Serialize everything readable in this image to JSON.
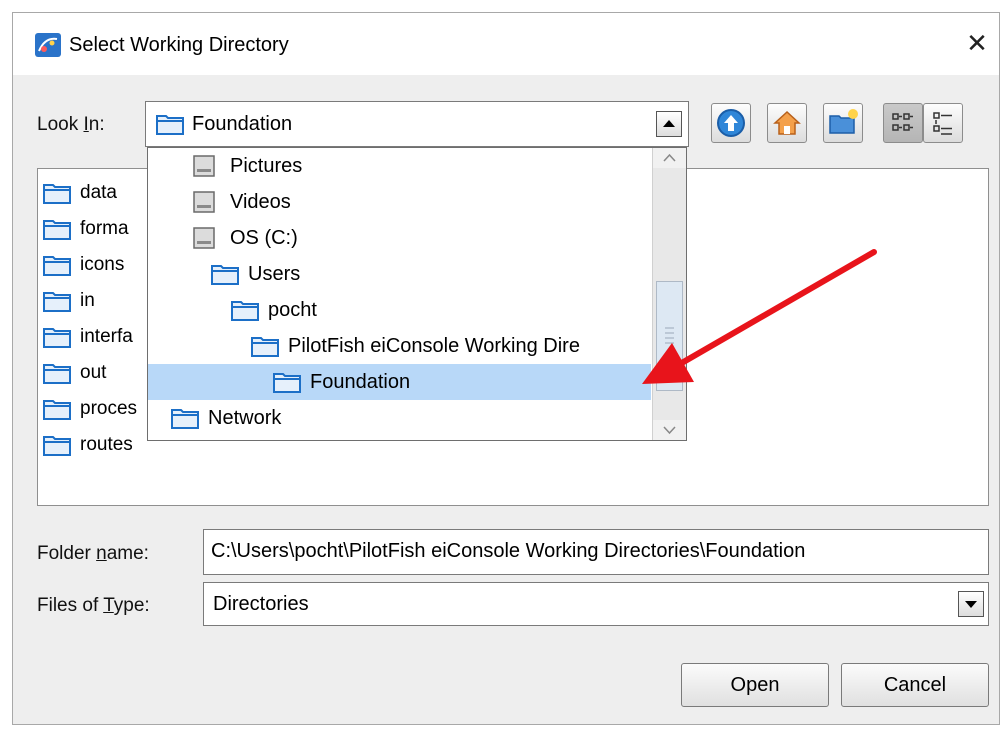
{
  "window": {
    "title": "Select Working Directory",
    "close_glyph": "✕"
  },
  "look_in": {
    "label_pre": "Look ",
    "label_mnemonic": "I",
    "label_post": "n:",
    "value": "Foundation"
  },
  "toolbar": {
    "icons": [
      "up-one-level-icon",
      "home-icon",
      "new-folder-icon",
      "list-view-icon",
      "details-view-icon"
    ],
    "active": "list-view-icon"
  },
  "file_list": {
    "items": [
      "data",
      "forma",
      "icons",
      "in",
      "interfa",
      "out",
      "proces",
      "routes"
    ]
  },
  "dropdown": {
    "items": [
      {
        "label": "Pictures",
        "icon": "drive-icon"
      },
      {
        "label": "Videos",
        "icon": "drive-icon"
      },
      {
        "label": "OS (C:)",
        "icon": "drive-icon"
      },
      {
        "label": "Users",
        "icon": "folder-icon"
      },
      {
        "label": "pocht",
        "icon": "folder-icon"
      },
      {
        "label": "PilotFish eiConsole Working Dire",
        "icon": "folder-icon"
      },
      {
        "label": "Foundation",
        "icon": "folder-icon",
        "selected": true
      },
      {
        "label": "Network",
        "icon": "folder-icon"
      }
    ]
  },
  "folder_name": {
    "label_pre": "Folder ",
    "label_mnemonic": "n",
    "label_post": "ame:",
    "value": "C:\\Users\\pocht\\PilotFish eiConsole Working Directories\\Foundation"
  },
  "files_of_type": {
    "label_pre": "Files of ",
    "label_mnemonic": "T",
    "label_post": "ype:",
    "value": "Directories"
  },
  "buttons": {
    "open": "Open",
    "cancel": "Cancel"
  },
  "colors": {
    "selection": "#b8d8f8",
    "arrow": "#e8141b",
    "folder": "#1c6fc7"
  }
}
